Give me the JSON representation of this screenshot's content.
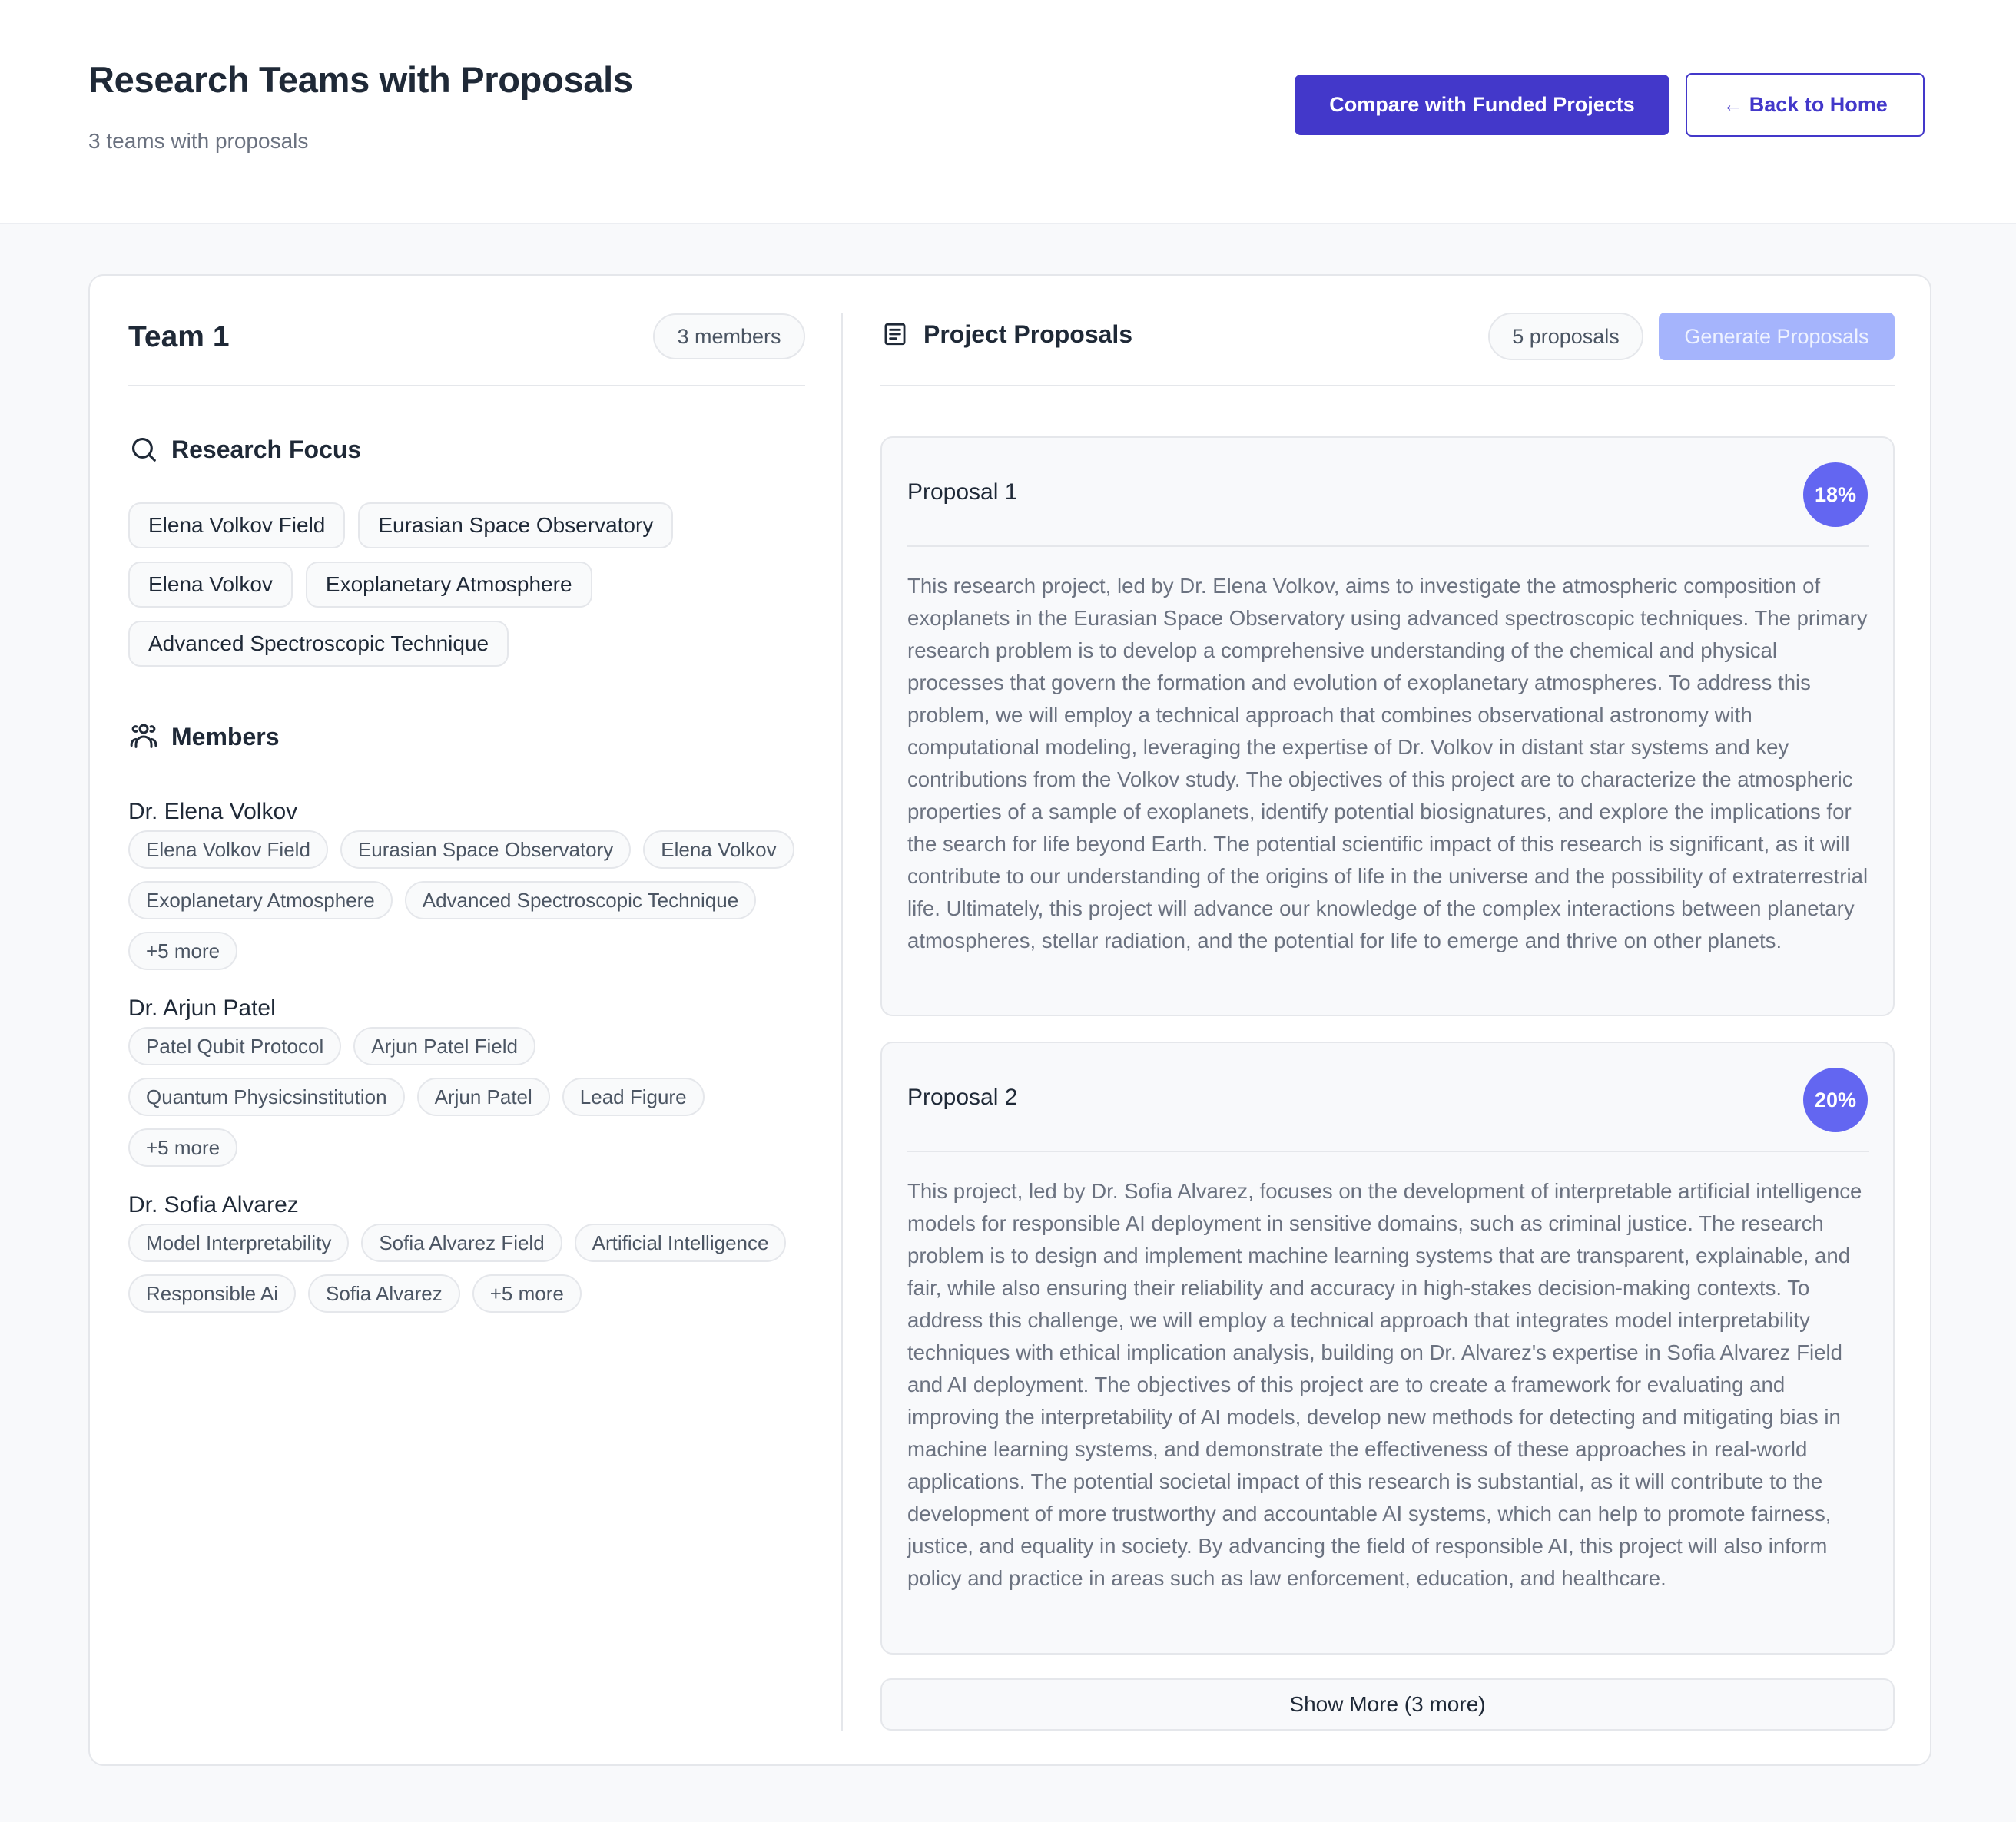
{
  "header": {
    "title": "Research Teams with Proposals",
    "subtitle": "3 teams with proposals",
    "compare_button": "Compare with Funded Projects",
    "back_button": "← Back to Home"
  },
  "team": {
    "title": "Team 1",
    "members_badge": "3 members",
    "research_focus": {
      "heading": "Research Focus",
      "icon": "search-icon",
      "tags": [
        "Elena Volkov Field",
        "Eurasian Space Observatory",
        "Elena Volkov",
        "Exoplanetary Atmosphere",
        "Advanced Spectroscopic Technique"
      ]
    },
    "members": {
      "heading": "Members",
      "icon": "users-icon",
      "list": [
        {
          "name": "Dr. Elena Volkov",
          "tags": [
            "Elena Volkov Field",
            "Eurasian Space Observatory",
            "Elena Volkov",
            "Exoplanetary Atmosphere",
            "Advanced Spectroscopic Technique",
            "+5 more"
          ]
        },
        {
          "name": "Dr. Arjun Patel",
          "tags": [
            "Patel Qubit Protocol",
            "Arjun Patel Field",
            "Quantum Physicsinstitution",
            "Arjun Patel",
            "Lead Figure",
            "+5 more"
          ]
        },
        {
          "name": "Dr. Sofia Alvarez",
          "tags": [
            "Model Interpretability",
            "Sofia Alvarez Field",
            "Artificial Intelligence",
            "Responsible Ai",
            "Sofia Alvarez",
            "+5 more"
          ]
        }
      ]
    }
  },
  "proposals": {
    "heading": "Project Proposals",
    "icon": "document-icon",
    "count_badge": "5 proposals",
    "generate_button": "Generate Proposals",
    "show_more": "Show More (3 more)",
    "colors": {
      "score_badge": "#6366f1",
      "primary": "#4338ca",
      "disabled": "#a5b4fc"
    },
    "items": [
      {
        "title": "Proposal 1",
        "score": "18%",
        "body": "This research project, led by Dr. Elena Volkov, aims to investigate the atmospheric composition of exoplanets in the Eurasian Space Observatory using advanced spectroscopic techniques. The primary research problem is to develop a comprehensive understanding of the chemical and physical processes that govern the formation and evolution of exoplanetary atmospheres. To address this problem, we will employ a technical approach that combines observational astronomy with computational modeling, leveraging the expertise of Dr. Volkov in distant star systems and key contributions from the Volkov study. The objectives of this project are to characterize the atmospheric properties of a sample of exoplanets, identify potential biosignatures, and explore the implications for the search for life beyond Earth. The potential scientific impact of this research is significant, as it will contribute to our understanding of the origins of life in the universe and the possibility of extraterrestrial life. Ultimately, this project will advance our knowledge of the complex interactions between planetary atmospheres, stellar radiation, and the potential for life to emerge and thrive on other planets."
      },
      {
        "title": "Proposal 2",
        "score": "20%",
        "body": "This project, led by Dr. Sofia Alvarez, focuses on the development of interpretable artificial intelligence models for responsible AI deployment in sensitive domains, such as criminal justice. The research problem is to design and implement machine learning systems that are transparent, explainable, and fair, while also ensuring their reliability and accuracy in high-stakes decision-making contexts. To address this challenge, we will employ a technical approach that integrates model interpretability techniques with ethical implication analysis, building on Dr. Alvarez's expertise in Sofia Alvarez Field and AI deployment. The objectives of this project are to create a framework for evaluating and improving the interpretability of AI models, develop new methods for detecting and mitigating bias in machine learning systems, and demonstrate the effectiveness of these approaches in real-world applications. The potential societal impact of this research is substantial, as it will contribute to the development of more trustworthy and accountable AI systems, which can help to promote fairness, justice, and equality in society. By advancing the field of responsible AI, this project will also inform policy and practice in areas such as law enforcement, education, and healthcare."
      }
    ]
  }
}
